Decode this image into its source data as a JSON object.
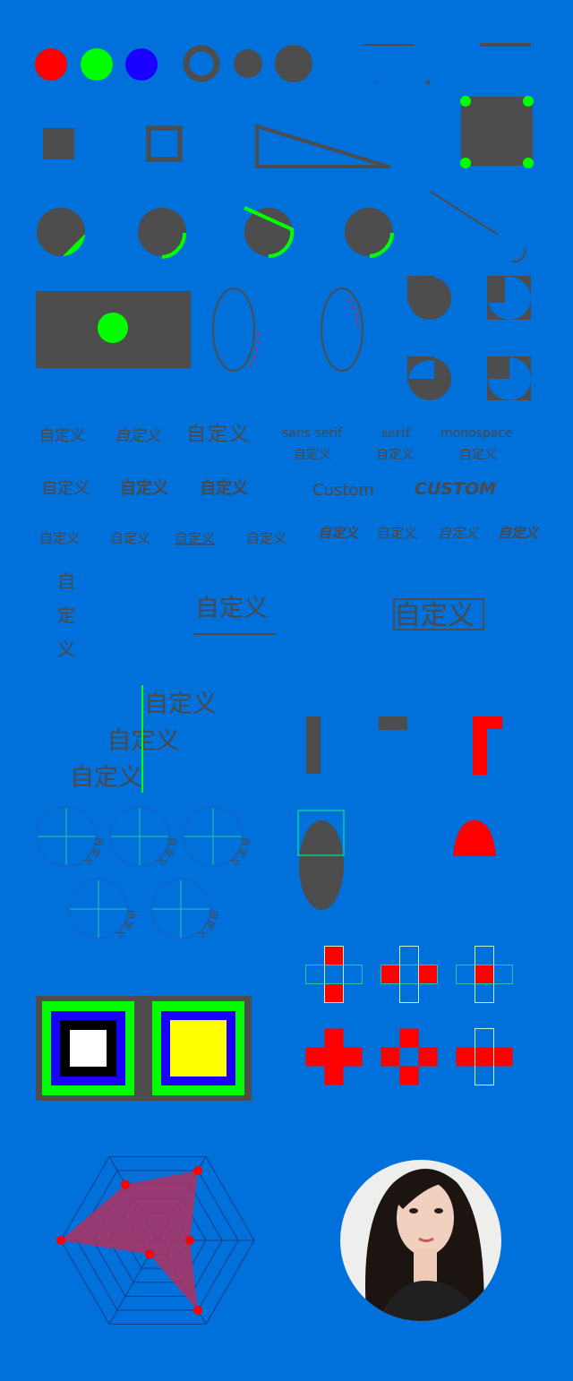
{
  "colors": {
    "background": "#0070da",
    "shape": "#4d4d4d",
    "red": "#ff0000",
    "green": "#00ff00",
    "blue": "#1a00ff",
    "yellow": "#ffff00",
    "radar_fill": "#b03060"
  },
  "text_rows": {
    "row1": [
      "自定义",
      "自定义",
      "自定义"
    ],
    "fonts": [
      {
        "name": "sans serif",
        "sample": "自定义"
      },
      {
        "name": "serif",
        "sample": "自定义"
      },
      {
        "name": "monospace",
        "sample": "自定义"
      }
    ],
    "row2": [
      "自定义",
      "自定义",
      "自定义",
      "Custom",
      "CUSTOM"
    ],
    "row3": [
      "自定义",
      "自定义",
      "自定义",
      "自定义",
      "自定义",
      "自定义",
      "自定义",
      "自定义"
    ],
    "vertical": [
      "自",
      "定",
      "义"
    ],
    "underlined": "自定义",
    "boxed": "自定义",
    "aligned": [
      "自定义",
      "自定义",
      "自定义"
    ]
  },
  "arc_texts": [
    "自定义",
    "自定义",
    "自定义",
    "自定义",
    "自定义"
  ],
  "photo": {
    "icon": "avatar-portrait"
  },
  "chart_data": {
    "type": "radar",
    "axes": 6,
    "levels": 6,
    "values": [
      2,
      5,
      4,
      6,
      1,
      5
    ],
    "grid": true
  }
}
